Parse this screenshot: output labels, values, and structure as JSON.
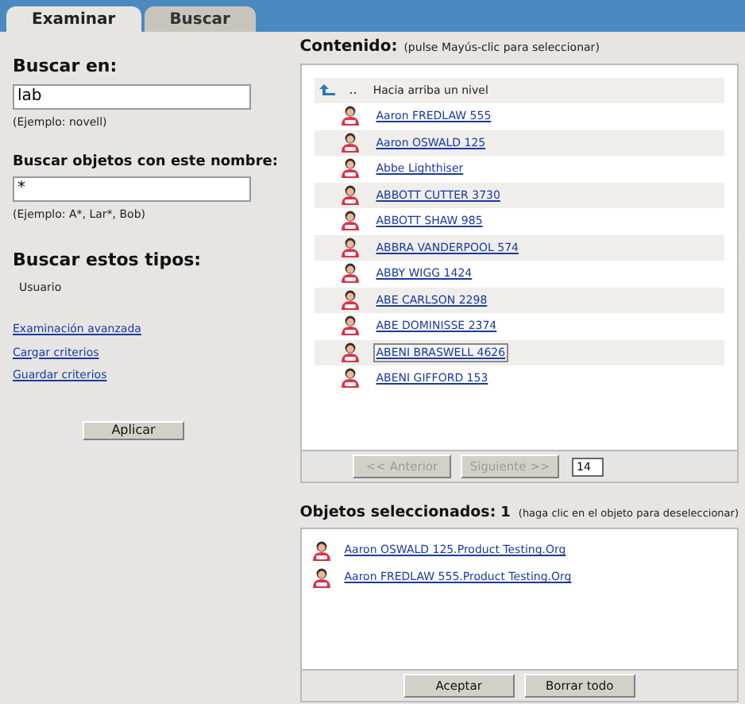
{
  "tabs": [
    {
      "label": "Examinar",
      "selected": true
    },
    {
      "label": "Buscar",
      "selected": false
    }
  ],
  "search_in": {
    "label": "Buscar en:",
    "value": "lab",
    "example": "(Ejemplo: novell)"
  },
  "name_search": {
    "label": "Buscar objetos con este nombre:",
    "value": "*",
    "example": "(Ejemplo: A*, Lar*, Bob)"
  },
  "types": {
    "label": "Buscar estos tipos:",
    "items": [
      "Usuario"
    ]
  },
  "links": [
    "Examinación avanzada",
    "Cargar criterios",
    "Guardar criterios"
  ],
  "apply_button": "Aplicar",
  "contents": {
    "title": "Contenido:",
    "hint": "(pulse Mayús-clic para seleccionar)",
    "up_row": {
      "dots": "..",
      "label": "Hacia arriba un nivel"
    },
    "items": [
      {
        "name": "Aaron FREDLAW 555",
        "focused": false
      },
      {
        "name": "Aaron OSWALD 125",
        "focused": false
      },
      {
        "name": "Abbe Lighthiser",
        "focused": false
      },
      {
        "name": "ABBOTT CUTTER 3730",
        "focused": false
      },
      {
        "name": "ABBOTT SHAW 985",
        "focused": false
      },
      {
        "name": "ABBRA VANDERPOOL 574",
        "focused": false
      },
      {
        "name": "ABBY WIGG 1424",
        "focused": false
      },
      {
        "name": "ABE CARLSON 2298",
        "focused": false
      },
      {
        "name": "ABE DOMINISSE 2374",
        "focused": false
      },
      {
        "name": "ABENI BRASWELL 4626",
        "focused": true
      },
      {
        "name": "ABENI GIFFORD 153",
        "focused": false
      }
    ],
    "prev_button": "<< Anterior",
    "next_button": "Siguiente >>",
    "page_size": "14"
  },
  "selected_objects": {
    "title": "Objetos seleccionados:",
    "count": "1",
    "hint": "(haga clic en el objeto para deseleccionar)",
    "items": [
      "Aaron OSWALD 125.Product Testing.Org",
      "Aaron FREDLAW 555.Product Testing.Org"
    ]
  },
  "buttons": [
    "Aceptar",
    "Borrar todo"
  ]
}
